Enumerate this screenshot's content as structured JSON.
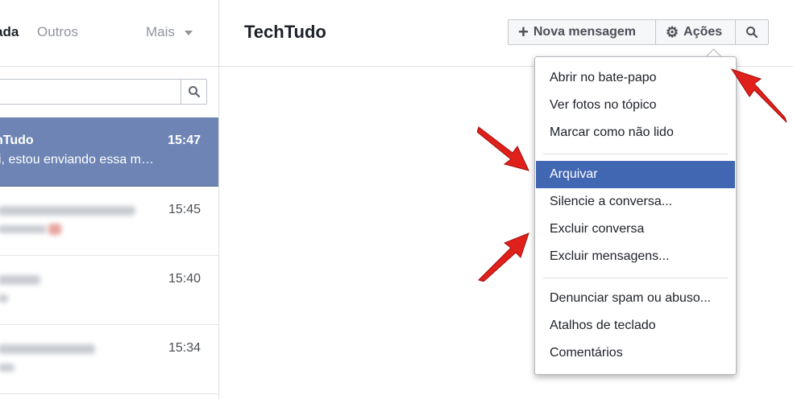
{
  "tabs": {
    "inbox": "ada",
    "others": "Outros",
    "more": "Mais"
  },
  "conversations": [
    {
      "name": "nTudo",
      "time": "15:47",
      "snippet": "i, estou enviando essa m…"
    },
    {
      "name": "",
      "time": "15:45",
      "snippet": ""
    },
    {
      "name": "",
      "time": "15:40",
      "snippet": ""
    },
    {
      "name": "",
      "time": "15:34",
      "snippet": ""
    }
  ],
  "header": {
    "title": "TechTudo",
    "new_message": "Nova mensagem",
    "actions": "Ações"
  },
  "menu": {
    "items": [
      "Abrir no bate-papo",
      "Ver fotos no tópico",
      "Marcar como não lido",
      "Arquivar",
      "Silencie a conversa...",
      "Excluir conversa",
      "Excluir mensagens...",
      "Denunciar spam ou abuso...",
      "Atalhos de teclado",
      "Comentários"
    ],
    "highlighted": "Arquivar"
  },
  "colors": {
    "accent": "#4267b2",
    "selected_row": "#6d84b4",
    "annotation_arrow": "#e0201b"
  },
  "icons": {
    "new_message": "plus-icon",
    "actions": "gear-icon",
    "search": "search-icon",
    "more": "caret-down-icon"
  }
}
